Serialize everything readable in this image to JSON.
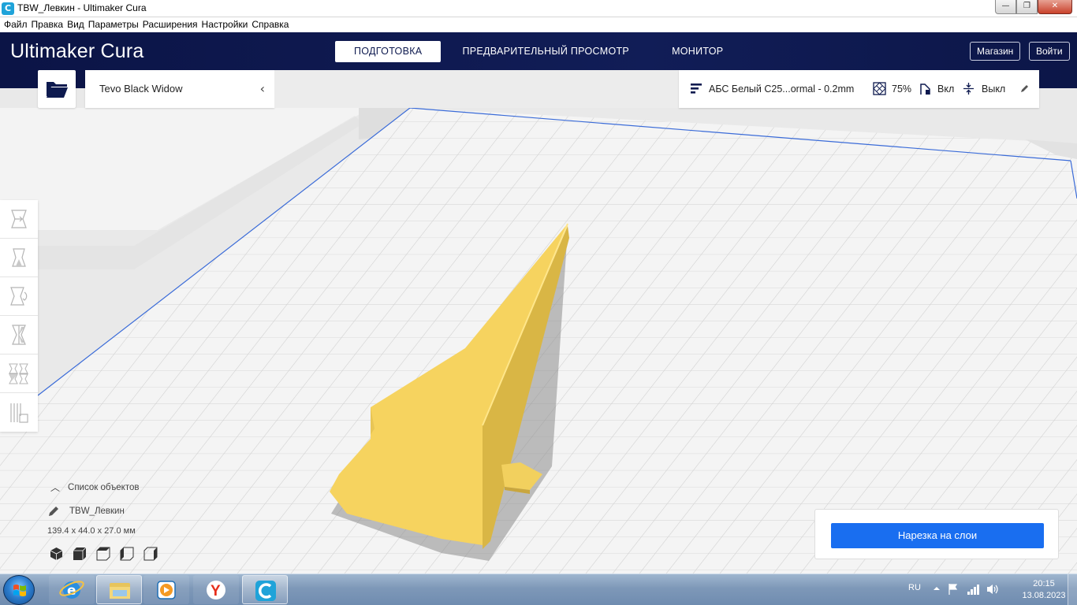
{
  "window": {
    "title": "TBW_Левкин - Ultimaker Cura",
    "buttons": {
      "minimize": "—",
      "maximize": "❐",
      "close": "✕"
    }
  },
  "menu": [
    "Файл",
    "Правка",
    "Вид",
    "Параметры",
    "Расширения",
    "Настройки",
    "Справка"
  ],
  "header": {
    "logo_bold": "Ultimaker",
    "logo_light": "Cura",
    "tabs": [
      {
        "label": "ПОДГОТОВКА",
        "active": true
      },
      {
        "label": "ПРЕДВАРИТЕЛЬНЫЙ ПРОСМОТР",
        "active": false
      },
      {
        "label": "МОНИТОР",
        "active": false
      }
    ],
    "marketplace": "Магазин",
    "signin": "Войти"
  },
  "printer": {
    "name": "Tevo Black Widow"
  },
  "print_settings": {
    "profile": "АБС Белый C25...ormal - 0.2mm",
    "infill": "75%",
    "support": "Вкл",
    "adhesion": "Выкл"
  },
  "tools": [
    "move-icon",
    "scale-icon",
    "rotate-icon",
    "mirror-icon",
    "per-model-settings-icon",
    "support-blocker-icon"
  ],
  "object_list": {
    "header": "Список объектов",
    "object_name": "TBW_Левкин",
    "dimensions": "139.4 x 44.0 x 27.0 мм"
  },
  "views": [
    "3d-view-icon",
    "front-view-icon",
    "top-view-icon",
    "left-view-icon",
    "right-view-icon"
  ],
  "slice_button": "Нарезка на слои",
  "colors": {
    "header_bg": "#0e1a4f",
    "model_yellow": "#f7d562",
    "slice_blue": "#196ef0"
  },
  "taskbar": {
    "lang": "RU",
    "time": "20:15",
    "date": "13.08.2023"
  }
}
